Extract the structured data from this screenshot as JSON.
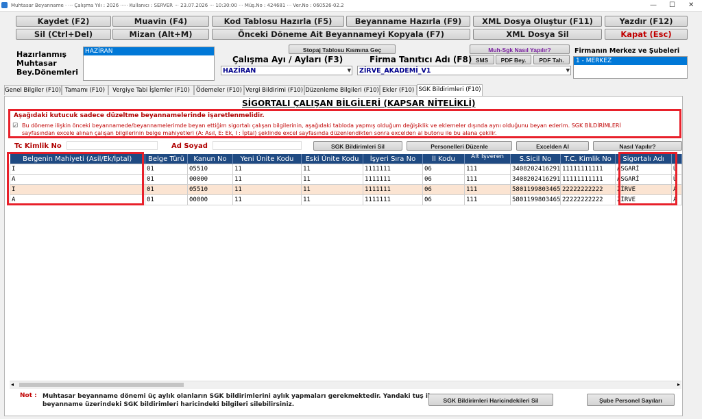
{
  "window": {
    "title": "Muhtasar Beyanname · ··· Çalışma Yılı : 2026 ····· Kullanıcı : SERVER ··· 23.07.2026 ··· 10:30:00 ··· Müş.No : 424681 ··· Ver.No : 060526-02.2",
    "controls": {
      "minimize": "—",
      "maximize": "☐",
      "close": "✕"
    }
  },
  "toolbar": {
    "row1": [
      "Kaydet (F2)",
      "Muavin (F4)",
      "Kod Tablosu Hazırla (F5)",
      "Beyanname Hazırla (F9)",
      "XML Dosya Oluştur (F11)",
      "Yazdır (F12)"
    ],
    "row2": [
      "Sil (Ctrl+Del)",
      "Mizan (Alt+M)",
      "Önceki Döneme Ait Beyannameyi Kopyala (F7)",
      "XML Dosya Sil",
      "Kapat (Esc)"
    ]
  },
  "prepared": {
    "label_line1": "Hazırlanmış",
    "label_line2": "Muhtasar",
    "label_line3": "Bey.Dönemleri",
    "selected": "HAZİRAN"
  },
  "stopaj_button": "Stopaj Tablosu Kısmına Geç",
  "muh_sgk_button": "Muh-Sgk Nasıl Yapılır?",
  "sms_button": "SMS",
  "pdf_bey_button": "PDF Bey.",
  "pdf_tah_button": "PDF Tah.",
  "work_month": {
    "label": "Çalışma Ayı / Ayları (F3)",
    "value": "HAZİRAN"
  },
  "company": {
    "label": "Firma Tanıtıcı Adı (F8)",
    "value": "ZİRVE_AKADEMİ_V1"
  },
  "branches": {
    "label": "Firmanın Merkez ve Şubeleri",
    "selected": "1 - MERKEZ"
  },
  "tabs": [
    "Genel Bilgiler (F10)",
    "Tamamı (F10)",
    "Vergiye Tabi İşlemler (F10)",
    "Ödemeler (F10)",
    "Vergi Bildirimi (F10)",
    "Düzenleme Bilgileri (F10)",
    "Ekler (F10)",
    "SGK Bildirimleri (F10)"
  ],
  "section_title": "SİGORTALI ÇALIŞAN BİLGİLERİ (KAPSAR NİTELİKLİ)",
  "warning": {
    "heading": "Aşağıdaki kutucuk sadece düzeltme beyannamelerinde işaretlenmelidir.",
    "checkbox": "☑",
    "text_line1": "Bu döneme ilişkin önceki beyannamede/beyannamelerimde beyan ettiğim sigortalı çalışan bilgilerinin, aşağıdaki tabloda yapmış olduğum değişiklik ve eklemeler dışında aynı olduğunu beyan ederim. SGK BİLDİRİMLERİ",
    "text_line2": "sayfasından excele alınan çalışan bilgilerinin belge mahiyetleri (A: Asıl, E: Ek, I : İptal) şeklinde excel sayfasında düzenlendikten sonra excelden al butonu ile bu alana çekilir."
  },
  "filters": {
    "tc_label": "Tc Kimlik No",
    "name_label": "Ad Soyad",
    "sgk_delete": "SGK Bildirimleri Sil",
    "edit_staff": "Personelleri Düzenle",
    "excel_import": "Excelden Al",
    "howto": "Nasıl Yapılır?"
  },
  "table": {
    "columns": [
      "Belgenin Mahiyeti (Asil/Ek/İptal)",
      "Belge Türü",
      "Kanun No",
      "Yeni Ünite Kodu",
      "Eski Ünite Kodu",
      "İşyeri Sıra No",
      "İl Kodu",
      "Alt İşveren",
      "S.Sicil No",
      "T.C. Kimlik No",
      "Sigortalı Adı",
      ""
    ],
    "rows": [
      [
        "I",
        "01",
        "05510",
        "11",
        "11",
        "1111111",
        "06",
        "111",
        "3408202416291",
        "11111111111",
        "ASGARİ",
        "Ü"
      ],
      [
        "A",
        "01",
        "00000",
        "11",
        "11",
        "1111111",
        "06",
        "111",
        "3408202416291",
        "11111111111",
        "ASGARİ",
        "Ü"
      ],
      [
        "I",
        "01",
        "05510",
        "11",
        "11",
        "1111111",
        "06",
        "111",
        "5801199803465",
        "22222222222",
        "ZİRVE",
        "A"
      ],
      [
        "A",
        "01",
        "00000",
        "11",
        "11",
        "1111111",
        "06",
        "111",
        "5801199803465",
        "22222222222",
        "ZİRVE",
        "A"
      ]
    ]
  },
  "footer": {
    "note_label": "Not :",
    "note_line1": "Muhtasar beyanname dönemi üç aylık olanların SGK bildirimlerini aylık yapmaları gerekmektedir. Yandaki tuş ile",
    "note_line2": "beyanname üzerindeki SGK bildirimleri haricindeki bilgileri silebilirsiniz.",
    "delete_other": "SGK Bildirimleri Haricindekileri Sil",
    "branch_staff": "Şube Personel Sayıları"
  },
  "colors": {
    "header": "#1f4a82",
    "highlight": "#e8202a",
    "selection": "#0078d7"
  }
}
